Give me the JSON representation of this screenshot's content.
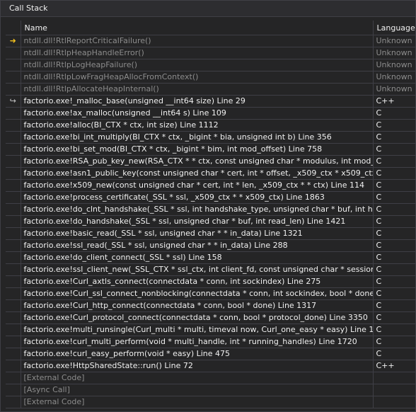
{
  "window": {
    "title": "Call Stack"
  },
  "columns": {
    "name": "Name",
    "language": "Language"
  },
  "frames": [
    {
      "marker": "current",
      "name": "ntdll.dll!RtlReportCriticalFailure()",
      "language": "Unknown",
      "style": "dim"
    },
    {
      "marker": "",
      "name": "ntdll.dll!RtlpHeapHandleError()",
      "language": "Unknown",
      "style": "dim"
    },
    {
      "marker": "",
      "name": "ntdll.dll!RtlpLogHeapFailure()",
      "language": "Unknown",
      "style": "dim"
    },
    {
      "marker": "",
      "name": "ntdll.dll!RtlpLowFragHeapAllocFromContext()",
      "language": "Unknown",
      "style": "dim"
    },
    {
      "marker": "",
      "name": "ntdll.dll!RtlpAllocateHeapInternal()",
      "language": "Unknown",
      "style": "dim"
    },
    {
      "marker": "return",
      "name": "factorio.exe!_malloc_base(unsigned __int64 size) Line 29",
      "language": "C++",
      "style": "user"
    },
    {
      "marker": "",
      "name": "factorio.exe!ax_malloc(unsigned __int64 s) Line 109",
      "language": "C",
      "style": "user"
    },
    {
      "marker": "",
      "name": "factorio.exe!alloc(BI_CTX * ctx, int size) Line 1112",
      "language": "C",
      "style": "user"
    },
    {
      "marker": "",
      "name": "factorio.exe!bi_int_multiply(BI_CTX * ctx, _bigint * bia, unsigned int b) Line 356",
      "language": "C",
      "style": "user"
    },
    {
      "marker": "",
      "name": "factorio.exe!bi_set_mod(BI_CTX * ctx, _bigint * bim, int mod_offset) Line 758",
      "language": "C",
      "style": "user"
    },
    {
      "marker": "",
      "name": "factorio.exe!RSA_pub_key_new(RSA_CTX * * ctx, const unsigned char * modulus, int mod_len,",
      "language": "C",
      "style": "user"
    },
    {
      "marker": "",
      "name": "factorio.exe!asn1_public_key(const unsigned char * cert, int * offset, _x509_ctx * x509_ctx) Line",
      "language": "C",
      "style": "user"
    },
    {
      "marker": "",
      "name": "factorio.exe!x509_new(const unsigned char * cert, int * len, _x509_ctx * * ctx) Line 114",
      "language": "C",
      "style": "user"
    },
    {
      "marker": "",
      "name": "factorio.exe!process_certificate(_SSL * ssl, _x509_ctx * * x509_ctx) Line 1863",
      "language": "C",
      "style": "user"
    },
    {
      "marker": "",
      "name": "factorio.exe!do_clnt_handshake(_SSL * ssl, int handshake_type, unsigned char * buf, int hs_ler",
      "language": "C",
      "style": "user"
    },
    {
      "marker": "",
      "name": "factorio.exe!do_handshake(_SSL * ssl, unsigned char * buf, int read_len) Line 1421",
      "language": "C",
      "style": "user"
    },
    {
      "marker": "",
      "name": "factorio.exe!basic_read(_SSL * ssl, unsigned char * * in_data) Line 1321",
      "language": "C",
      "style": "user"
    },
    {
      "marker": "",
      "name": "factorio.exe!ssl_read(_SSL * ssl, unsigned char * * in_data) Line 288",
      "language": "C",
      "style": "user"
    },
    {
      "marker": "",
      "name": "factorio.exe!do_client_connect(_SSL * ssl) Line 158",
      "language": "C",
      "style": "user"
    },
    {
      "marker": "",
      "name": "factorio.exe!ssl_client_new(_SSL_CTX * ssl_ctx, int client_fd, const unsigned char * session_id,",
      "language": "C",
      "style": "user"
    },
    {
      "marker": "",
      "name": "factorio.exe!Curl_axtls_connect(connectdata * conn, int sockindex) Line 275",
      "language": "C",
      "style": "user"
    },
    {
      "marker": "",
      "name": "factorio.exe!Curl_ssl_connect_nonblocking(connectdata * conn, int sockindex, bool * done) L",
      "language": "C",
      "style": "user"
    },
    {
      "marker": "",
      "name": "factorio.exe!Curl_http_connect(connectdata * conn, bool * done) Line 1317",
      "language": "C",
      "style": "user"
    },
    {
      "marker": "",
      "name": "factorio.exe!Curl_protocol_connect(connectdata * conn, bool * protocol_done) Line 3350",
      "language": "C",
      "style": "user"
    },
    {
      "marker": "",
      "name": "factorio.exe!multi_runsingle(Curl_multi * multi, timeval now, Curl_one_easy * easy) Line 1138",
      "language": "C",
      "style": "user"
    },
    {
      "marker": "",
      "name": "factorio.exe!curl_multi_perform(void * multi_handle, int * running_handles) Line 1720",
      "language": "C",
      "style": "user"
    },
    {
      "marker": "",
      "name": "factorio.exe!curl_easy_perform(void * easy) Line 475",
      "language": "C",
      "style": "user"
    },
    {
      "marker": "",
      "name": "factorio.exe!HttpSharedState::run() Line 72",
      "language": "C++",
      "style": "user"
    },
    {
      "marker": "",
      "name": "[External Code]",
      "language": "",
      "style": "ext"
    },
    {
      "marker": "",
      "name": "[Async Call]",
      "language": "",
      "style": "ext"
    },
    {
      "marker": "",
      "name": "[External Code]",
      "language": "",
      "style": "ext"
    }
  ],
  "icons": {
    "current": "current-frame-arrow-icon",
    "return": "return-frame-arrow-icon"
  },
  "colors": {
    "background": "#252526",
    "current_arrow": "#f2c01e",
    "dim_text": "#8c8c8c",
    "text": "#f1f1f1"
  }
}
